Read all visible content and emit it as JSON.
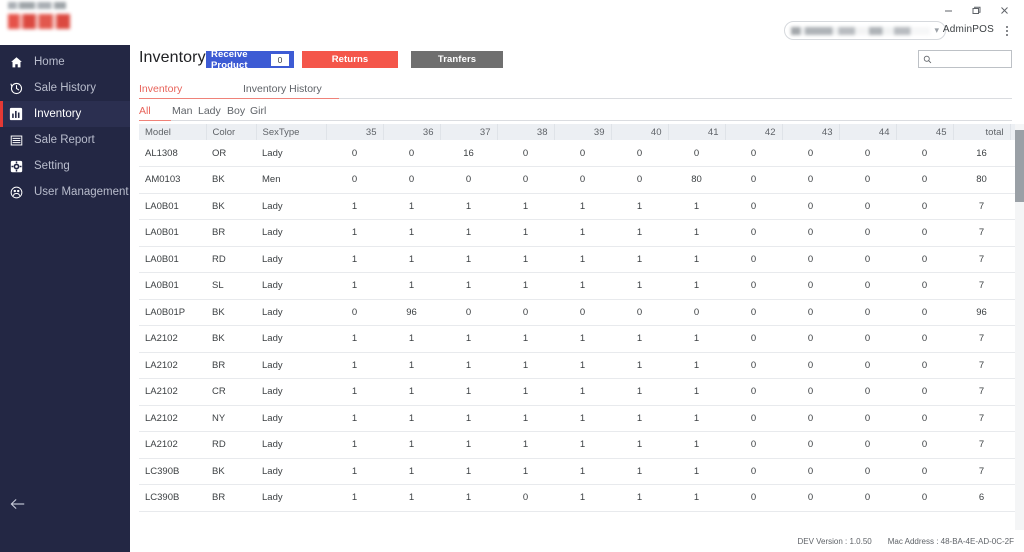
{
  "window": {
    "minimize_icon": "minimize-icon",
    "restore_icon": "restore-icon",
    "close_icon": "close-icon"
  },
  "header": {
    "account_caret_icon": "chevron-down-icon",
    "admin_label": "AdminPOS",
    "kebab_icon": "more-vertical-icon"
  },
  "sidebar": {
    "items": [
      {
        "label": "Home",
        "icon": "home-icon",
        "active": false
      },
      {
        "label": "Sale History",
        "icon": "history-clock-icon",
        "active": false
      },
      {
        "label": "Inventory",
        "icon": "bar-chart-icon",
        "active": true
      },
      {
        "label": "Sale Report",
        "icon": "list-report-icon",
        "active": false
      },
      {
        "label": "Setting",
        "icon": "gear-icon",
        "active": false
      },
      {
        "label": "User Management",
        "icon": "users-icon",
        "active": false
      }
    ],
    "back_icon": "arrow-left-icon",
    "background": "#232744",
    "active_accent": "#e53935"
  },
  "page": {
    "title": "Inventory",
    "buttons": {
      "receive_product": {
        "label": "Receive Product",
        "count": "0",
        "color": "#3d5bd4"
      },
      "returns": {
        "label": "Returns",
        "color": "#f4564a"
      },
      "transfers": {
        "label": "Tranfers",
        "color": "#6f6f6f"
      }
    },
    "search": {
      "value": "",
      "placeholder": "",
      "icon": "search-icon"
    },
    "tabs": [
      {
        "label": "Inventory",
        "active": true
      },
      {
        "label": "Inventory History",
        "active": false
      }
    ],
    "sub_tabs": [
      {
        "label": "All",
        "active": true
      },
      {
        "label": "Man",
        "active": false
      },
      {
        "label": "Lady",
        "active": false
      },
      {
        "label": "Boy",
        "active": false
      },
      {
        "label": "Girl",
        "active": false
      }
    ]
  },
  "table": {
    "columns": [
      "Model",
      "Color",
      "SexType",
      "35",
      "36",
      "37",
      "38",
      "39",
      "40",
      "41",
      "42",
      "43",
      "44",
      "45",
      "total"
    ],
    "row_action_icon": "refresh-icon",
    "rows": [
      {
        "model": "AL1308",
        "color": "OR",
        "sextype": "Lady",
        "sizes": [
          "0",
          "0",
          "16",
          "0",
          "0",
          "0",
          "0",
          "0",
          "0",
          "0",
          "0"
        ],
        "total": "16"
      },
      {
        "model": "AM0103",
        "color": "BK",
        "sextype": "Men",
        "sizes": [
          "0",
          "0",
          "0",
          "0",
          "0",
          "0",
          "80",
          "0",
          "0",
          "0",
          "0"
        ],
        "total": "80"
      },
      {
        "model": "LA0B01",
        "color": "BK",
        "sextype": "Lady",
        "sizes": [
          "1",
          "1",
          "1",
          "1",
          "1",
          "1",
          "1",
          "0",
          "0",
          "0",
          "0"
        ],
        "total": "7"
      },
      {
        "model": "LA0B01",
        "color": "BR",
        "sextype": "Lady",
        "sizes": [
          "1",
          "1",
          "1",
          "1",
          "1",
          "1",
          "1",
          "0",
          "0",
          "0",
          "0"
        ],
        "total": "7"
      },
      {
        "model": "LA0B01",
        "color": "RD",
        "sextype": "Lady",
        "sizes": [
          "1",
          "1",
          "1",
          "1",
          "1",
          "1",
          "1",
          "0",
          "0",
          "0",
          "0"
        ],
        "total": "7"
      },
      {
        "model": "LA0B01",
        "color": "SL",
        "sextype": "Lady",
        "sizes": [
          "1",
          "1",
          "1",
          "1",
          "1",
          "1",
          "1",
          "0",
          "0",
          "0",
          "0"
        ],
        "total": "7"
      },
      {
        "model": "LA0B01P",
        "color": "BK",
        "sextype": "Lady",
        "sizes": [
          "0",
          "96",
          "0",
          "0",
          "0",
          "0",
          "0",
          "0",
          "0",
          "0",
          "0"
        ],
        "total": "96"
      },
      {
        "model": "LA2102",
        "color": "BK",
        "sextype": "Lady",
        "sizes": [
          "1",
          "1",
          "1",
          "1",
          "1",
          "1",
          "1",
          "0",
          "0",
          "0",
          "0"
        ],
        "total": "7"
      },
      {
        "model": "LA2102",
        "color": "BR",
        "sextype": "Lady",
        "sizes": [
          "1",
          "1",
          "1",
          "1",
          "1",
          "1",
          "1",
          "0",
          "0",
          "0",
          "0"
        ],
        "total": "7"
      },
      {
        "model": "LA2102",
        "color": "CR",
        "sextype": "Lady",
        "sizes": [
          "1",
          "1",
          "1",
          "1",
          "1",
          "1",
          "1",
          "0",
          "0",
          "0",
          "0"
        ],
        "total": "7"
      },
      {
        "model": "LA2102",
        "color": "NY",
        "sextype": "Lady",
        "sizes": [
          "1",
          "1",
          "1",
          "1",
          "1",
          "1",
          "1",
          "0",
          "0",
          "0",
          "0"
        ],
        "total": "7"
      },
      {
        "model": "LA2102",
        "color": "RD",
        "sextype": "Lady",
        "sizes": [
          "1",
          "1",
          "1",
          "1",
          "1",
          "1",
          "1",
          "0",
          "0",
          "0",
          "0"
        ],
        "total": "7"
      },
      {
        "model": "LC390B",
        "color": "BK",
        "sextype": "Lady",
        "sizes": [
          "1",
          "1",
          "1",
          "1",
          "1",
          "1",
          "1",
          "0",
          "0",
          "0",
          "0"
        ],
        "total": "7"
      },
      {
        "model": "LC390B",
        "color": "BR",
        "sextype": "Lady",
        "sizes": [
          "1",
          "1",
          "1",
          "0",
          "1",
          "1",
          "1",
          "0",
          "0",
          "0",
          "0"
        ],
        "total": "6"
      }
    ]
  },
  "footer": {
    "version": "DEV Version : 1.0.50",
    "mac_address": "Mac Address :  48-BA-4E-AD-0C-2F"
  }
}
